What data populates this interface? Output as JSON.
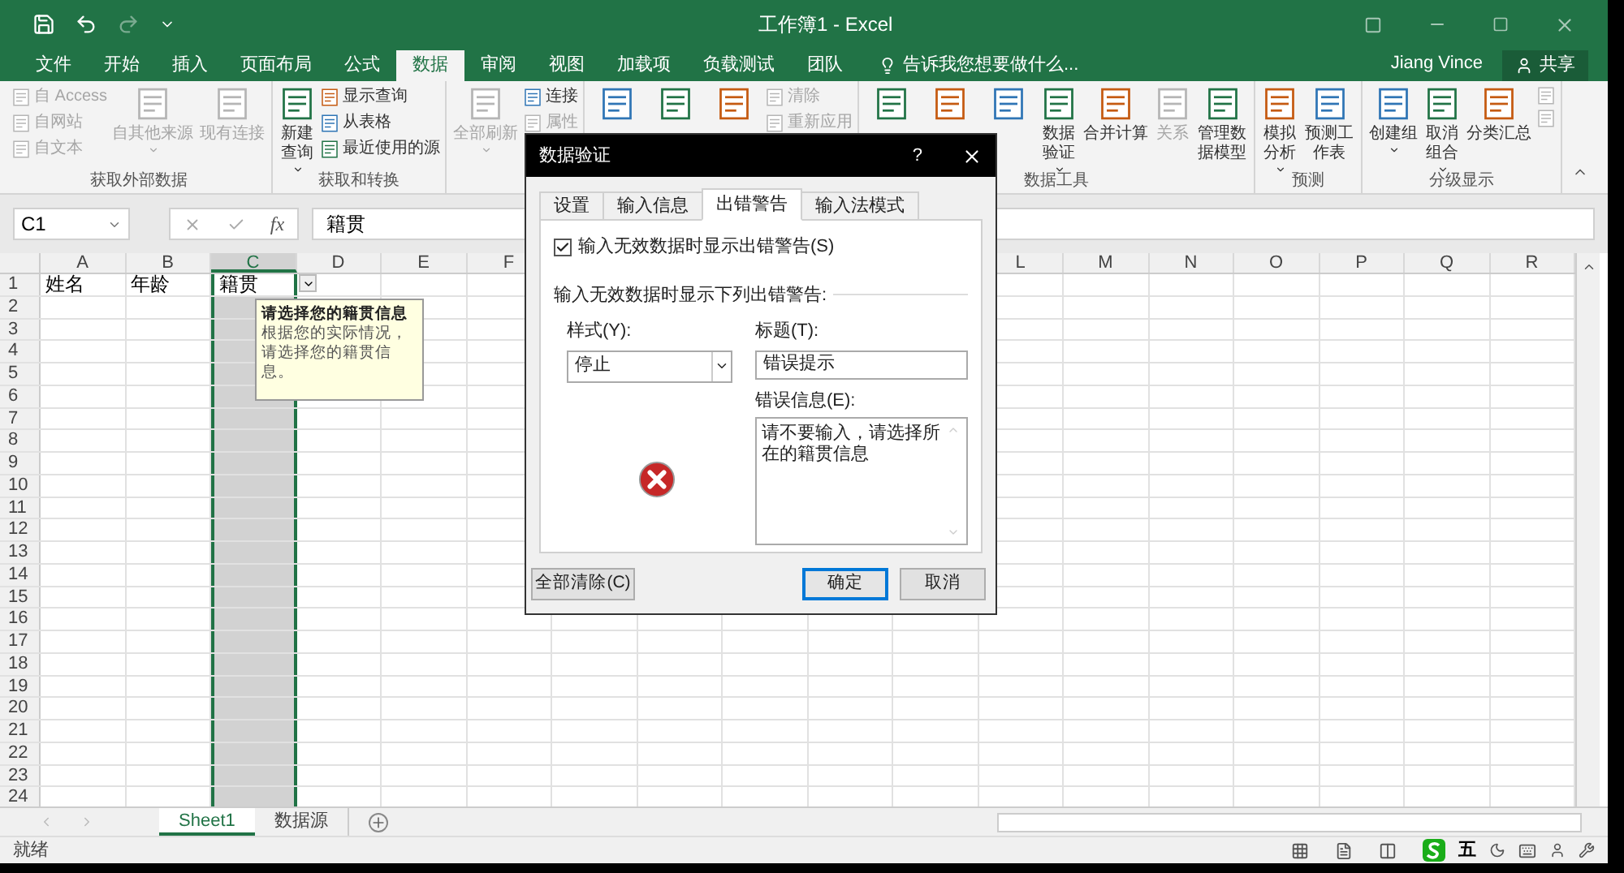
{
  "window": {
    "title": "工作簿1 - Excel",
    "user": "Jiang Vince",
    "share": "共享"
  },
  "ribbon_tabs": [
    {
      "label": "文件",
      "selected": false
    },
    {
      "label": "开始",
      "selected": false
    },
    {
      "label": "插入",
      "selected": false
    },
    {
      "label": "页面布局",
      "selected": false
    },
    {
      "label": "公式",
      "selected": false
    },
    {
      "label": "数据",
      "selected": true
    },
    {
      "label": "审阅",
      "selected": false
    },
    {
      "label": "视图",
      "selected": false
    },
    {
      "label": "加载项",
      "selected": false
    },
    {
      "label": "负载测试",
      "selected": false
    },
    {
      "label": "团队",
      "selected": false
    }
  ],
  "tell_me": "告诉我您想要做什么...",
  "ribbon_groups": [
    {
      "label": "获取外部数据",
      "items": [
        {
          "kind": "small",
          "label": "自 Access",
          "disabled": true
        },
        {
          "kind": "small",
          "label": "自网站",
          "disabled": true
        },
        {
          "kind": "small",
          "label": "自文本",
          "disabled": true
        },
        {
          "kind": "large",
          "label": "自其他来源",
          "disabled": true,
          "dropdown": true
        },
        {
          "kind": "large",
          "label": "现有连接",
          "disabled": true
        }
      ]
    },
    {
      "label": "获取和转换",
      "items": [
        {
          "kind": "large",
          "label": "新建查询",
          "disabled": false,
          "dropdown": true
        },
        {
          "kind": "small",
          "label": "显示查询",
          "disabled": false
        },
        {
          "kind": "small",
          "label": "从表格",
          "disabled": false
        },
        {
          "kind": "small",
          "label": "最近使用的源",
          "disabled": false
        }
      ]
    },
    {
      "items": [
        {
          "kind": "large",
          "label": "全部刷新",
          "disabled": true,
          "dropdown": true
        },
        {
          "kind": "small",
          "label": "连接",
          "disabled": false
        },
        {
          "kind": "small",
          "label": "属性",
          "disabled": true
        }
      ]
    },
    {
      "items": [
        {
          "kind": "large",
          "disabled": false
        },
        {
          "kind": "large",
          "disabled": false
        },
        {
          "kind": "large",
          "disabled": false
        },
        {
          "kind": "small",
          "label": "清除",
          "disabled": true
        },
        {
          "kind": "small",
          "label": "重新应用",
          "disabled": true
        }
      ]
    },
    {
      "label": "数据工具",
      "items": [
        {
          "kind": "large",
          "disabled": false
        },
        {
          "kind": "large",
          "disabled": false
        },
        {
          "kind": "large",
          "disabled": false
        },
        {
          "kind": "large",
          "label": "数据验证",
          "disabled": false,
          "dropdown": true
        },
        {
          "kind": "large",
          "label": "合并计算",
          "disabled": false
        },
        {
          "kind": "large",
          "label": "关系",
          "disabled": true
        },
        {
          "kind": "large",
          "label": "管理数据模型",
          "disabled": false
        }
      ]
    },
    {
      "label": "预测",
      "items": [
        {
          "kind": "large",
          "label": "模拟分析",
          "disabled": false,
          "dropdown": true
        },
        {
          "kind": "large",
          "label": "预测工作表",
          "disabled": false
        }
      ]
    },
    {
      "label": "分级显示",
      "items": [
        {
          "kind": "large",
          "label": "创建组",
          "disabled": false,
          "dropdown": true
        },
        {
          "kind": "large",
          "label": "取消组合",
          "disabled": false,
          "dropdown": true
        },
        {
          "kind": "large",
          "label": "分类汇总",
          "disabled": false
        },
        {
          "kind": "small",
          "disabled": true
        },
        {
          "kind": "small",
          "disabled": true
        }
      ]
    }
  ],
  "formula_bar": {
    "name_box": "C1",
    "fx": "fx",
    "value": "籍贯"
  },
  "columns": [
    {
      "label": "A",
      "selected": false
    },
    {
      "label": "B",
      "selected": false
    },
    {
      "label": "C",
      "selected": true
    },
    {
      "label": "D",
      "selected": false
    },
    {
      "label": "E",
      "selected": false
    },
    {
      "label": "F",
      "selected": false
    },
    {},
    {},
    {},
    {},
    {},
    {
      "label": "L",
      "selected": false
    },
    {
      "label": "M",
      "selected": false
    },
    {
      "label": "N",
      "selected": false
    },
    {
      "label": "O",
      "selected": false
    },
    {
      "label": "P",
      "selected": false
    },
    {
      "label": "Q",
      "selected": false
    },
    {
      "label": "R",
      "selected": false
    }
  ],
  "rows": [
    {
      "number": "1",
      "cells": [
        "姓名",
        "年龄",
        "籍贯"
      ]
    },
    {
      "number": "2"
    },
    {
      "number": "3"
    },
    {
      "number": "4"
    },
    {
      "number": "5"
    },
    {
      "number": "6"
    },
    {
      "number": "7"
    },
    {
      "number": "8"
    },
    {
      "number": "9"
    },
    {
      "number": "10"
    },
    {
      "number": "11"
    },
    {
      "number": "12"
    },
    {
      "number": "13"
    },
    {
      "number": "14"
    },
    {
      "number": "15"
    },
    {
      "number": "16"
    },
    {
      "number": "17"
    },
    {
      "number": "18"
    },
    {
      "number": "19"
    },
    {
      "number": "20"
    },
    {
      "number": "21"
    },
    {
      "number": "22"
    },
    {
      "number": "23"
    },
    {
      "number": "24"
    }
  ],
  "input_tip": {
    "title": "请选择您的籍贯信息",
    "body": "根据您的实际情况，请选择您的籍贯信息。"
  },
  "dialog": {
    "title": "数据验证",
    "help": "?",
    "tabs": [
      {
        "label": "设置",
        "selected": false
      },
      {
        "label": "输入信息",
        "selected": false
      },
      {
        "label": "出错警告",
        "selected": true
      },
      {
        "label": "输入法模式",
        "selected": false
      }
    ],
    "show_alert": {
      "label": "输入无效数据时显示出错警告(S)",
      "checked": true
    },
    "section": "输入无效数据时显示下列出错警告:",
    "style": {
      "label": "样式(Y):",
      "value": "停止"
    },
    "alert_title": {
      "label": "标题(T):",
      "value": "错误提示"
    },
    "message": {
      "label": "错误信息(E):",
      "value": "请不要输入，请选择所在的籍贯信息"
    },
    "buttons": [
      {
        "label": "全部清除(C)",
        "kind": "secondary"
      },
      {
        "label": "确定",
        "kind": "default"
      },
      {
        "label": "取消",
        "kind": "secondary"
      }
    ]
  },
  "sheets": [
    {
      "label": "Sheet1",
      "selected": true
    },
    {
      "label": "数据源",
      "selected": false
    }
  ],
  "status_bar": {
    "status": "就绪",
    "ime_mode": "五"
  }
}
